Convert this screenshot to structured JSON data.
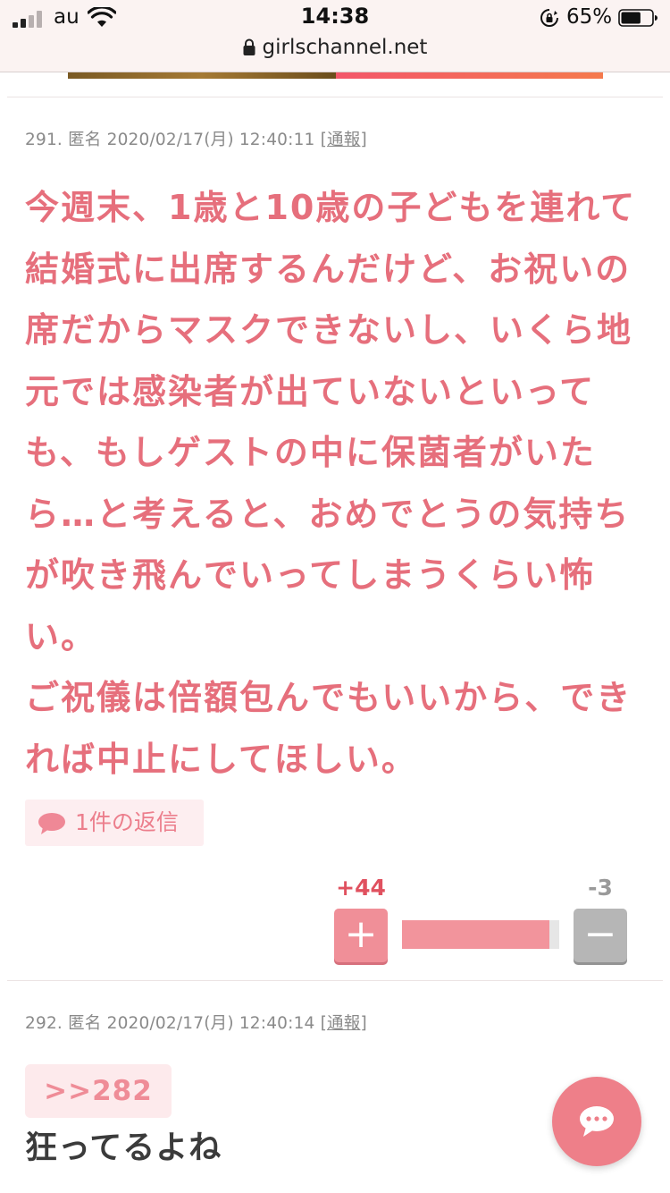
{
  "status": {
    "carrier": "au",
    "time": "14:38",
    "battery": "65%",
    "battery_level": 0.65,
    "url": "girlschannel.net"
  },
  "comment1": {
    "number": "291.",
    "author": "匿名",
    "datetime": "2020/02/17(月) 12:40:11",
    "report_open": "[",
    "report_label": "通報",
    "report_close": "]",
    "body": "今週末、1歳と10歳の子どもを連れて\n結婚式に出席するんだけど、お祝いの\n席だからマスクできないし、いくら地\n元では感染者が出ていないといって\nも、もしゲストの中に保菌者がいた\nら…と考えると、おめでとうの気持ち\nが吹き飛んでいってしまうくらい怖\nい。\nご祝儀は倍額包んでもいいから、でき\nれば中止にしてほしい。",
    "reply_label": "1件の返信",
    "plus_count": "+44",
    "minus_count": "-3",
    "plus_symbol": "+",
    "minus_symbol": "−",
    "vote_ratio": 0.936
  },
  "comment2": {
    "number": "292.",
    "author": "匿名",
    "datetime": "2020/02/17(月) 12:40:14",
    "report_open": "[",
    "report_label": "通報",
    "report_close": "]",
    "anchor": ">>282",
    "body": "狂ってるよね"
  },
  "colors": {
    "accent": "#e66f7c",
    "plus": "#f08f98",
    "minus": "#b6b6b6",
    "fab": "#ee7f89"
  },
  "icons": {
    "signal": "signal-icon",
    "wifi": "wifi-icon",
    "orientation_lock": "orientation-lock-icon",
    "battery": "battery-icon",
    "padlock": "padlock-icon",
    "reply": "speech-bubble-icon",
    "fab": "chat-icon"
  }
}
